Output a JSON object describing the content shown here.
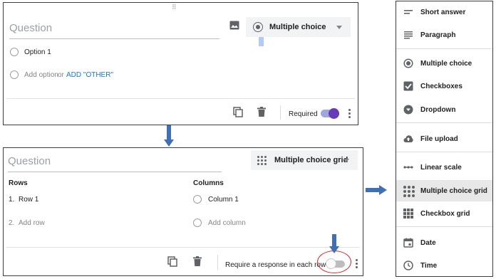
{
  "card1": {
    "question_placeholder": "Question",
    "type_select_label": "Multiple choice",
    "option1": "Option 1",
    "add_option": "Add option",
    "or": "or",
    "add_other": "ADD \"OTHER\"",
    "required_label": "Required",
    "required_on": true
  },
  "card2": {
    "question_placeholder": "Question",
    "type_select_label": "Multiple choice grid",
    "rows_header": "Rows",
    "columns_header": "Columns",
    "row1_index": "1.",
    "row1_label": "Row 1",
    "row2_index": "2.",
    "add_row": "Add row",
    "column1_label": "Column 1",
    "add_column": "Add column",
    "require_each_row_label": "Require a response in each row",
    "require_each_row_on": false
  },
  "menu": {
    "items": [
      {
        "label": "Short answer",
        "icon": "short-answer-icon"
      },
      {
        "label": "Paragraph",
        "icon": "paragraph-icon"
      },
      {
        "label": "Multiple choice",
        "icon": "radio-icon"
      },
      {
        "label": "Checkboxes",
        "icon": "checkbox-icon"
      },
      {
        "label": "Dropdown",
        "icon": "dropdown-icon"
      },
      {
        "label": "File upload",
        "icon": "upload-icon"
      },
      {
        "label": "Linear scale",
        "icon": "linear-scale-icon"
      },
      {
        "label": "Multiple choice grid",
        "icon": "dot-grid-icon"
      },
      {
        "label": "Checkbox grid",
        "icon": "checkbox-grid-icon"
      },
      {
        "label": "Date",
        "icon": "calendar-icon"
      },
      {
        "label": "Time",
        "icon": "clock-icon"
      }
    ],
    "highlighted_item": "Multiple choice grid"
  },
  "colors": {
    "toggle_on": "#673ab7",
    "toggle_on_track": "#9fa8da",
    "link": "#1a73e8",
    "annotation_arrow": "#3f6fb5",
    "annotation_circle": "#d32f2f"
  }
}
